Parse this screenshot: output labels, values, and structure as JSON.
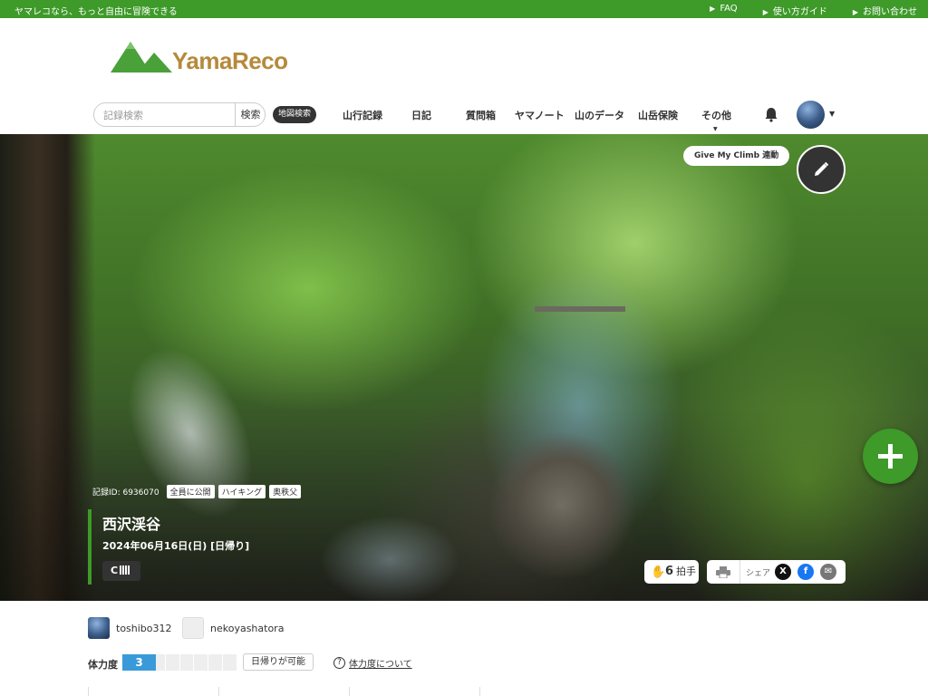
{
  "topbar": {
    "tagline": "ヤマレコなら、もっと自由に冒険できる",
    "links": [
      "FAQ",
      "使い方ガイド",
      "お問い合わせ"
    ]
  },
  "logo": {
    "text": "YamaReco"
  },
  "search": {
    "placeholder": "記録検索",
    "button": "検索",
    "map_button": "地図検索"
  },
  "nav": {
    "items": [
      "山行記録",
      "日記",
      "質問箱",
      "ヤマノート",
      "山のデータ",
      "山岳保険",
      "その他"
    ]
  },
  "hero": {
    "give_my_climb": "Give My Climb 連動",
    "record_id": "記録ID: 6936070",
    "tags": [
      "全員に公開",
      "ハイキング",
      "奥秩父"
    ],
    "title": "西沢渓谷",
    "date": "2024年06月16日(日) [日帰り]",
    "badge": "C",
    "applause_count": "6",
    "applause_label": "拍手",
    "share_label": "シェア"
  },
  "members": [
    "toshibo312",
    "nekoyashatora"
  ],
  "stamina": {
    "label": "体力度",
    "value": "3",
    "tip": "日帰りが可能",
    "help": "体力度について"
  },
  "colors": {
    "brand_green": "#3e9a29",
    "stamina_blue": "#3a9ad9"
  }
}
